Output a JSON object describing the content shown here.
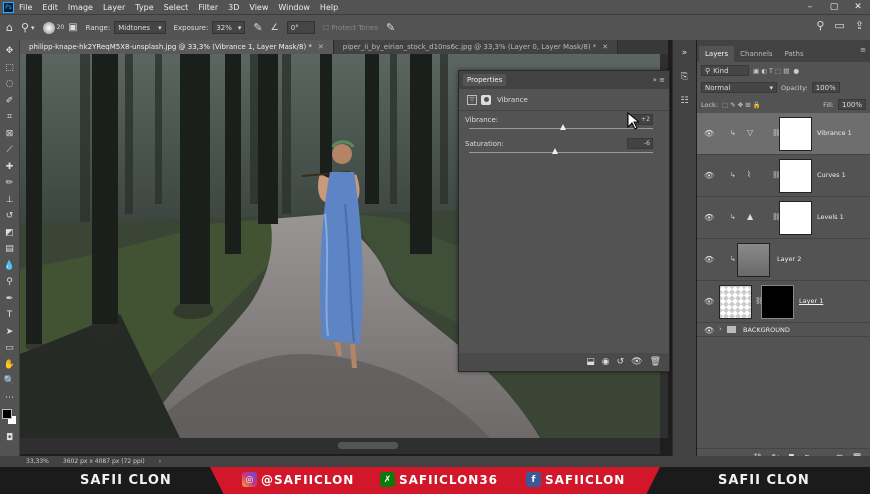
{
  "menu": {
    "logo": "Ps",
    "items": [
      "File",
      "Edit",
      "Image",
      "Layer",
      "Type",
      "Select",
      "Filter",
      "3D",
      "View",
      "Window",
      "Help"
    ]
  },
  "options": {
    "brush_size": "20",
    "range_label": "Range:",
    "range_value": "Midtones",
    "exposure_label": "Exposure:",
    "exposure_value": "32%",
    "angle_value": "0°",
    "protect_tones": "Protect Tones"
  },
  "tabs": [
    {
      "label": "philipp-knape-hk2YReqM5X8-unsplash.jpg @ 33,3% (Vibrance 1, Layer Mask/8) *",
      "active": true
    },
    {
      "label": "piper_ii_by_eirian_stock_d10ns6c.jpg @ 33,3% (Layer 0, Layer Mask/8) *",
      "active": false
    }
  ],
  "properties": {
    "title": "Properties",
    "adjustment_name": "Vibrance",
    "sliders": [
      {
        "label": "Vibrance:",
        "value": "+2",
        "pos": 0.51
      },
      {
        "label": "Saturation:",
        "value": "-6",
        "pos": 0.47
      }
    ]
  },
  "panel": {
    "tabs": [
      "Layers",
      "Channels",
      "Paths"
    ],
    "kind_filter": "Kind",
    "blend_mode": "Normal",
    "opacity_label": "Opacity:",
    "opacity_value": "100%",
    "lock_label": "Lock:",
    "fill_label": "Fill:",
    "fill_value": "100%"
  },
  "layers": [
    {
      "name": "Vibrance 1",
      "type": "vibrance",
      "selected": true
    },
    {
      "name": "Curves 1",
      "type": "curves",
      "selected": false
    },
    {
      "name": "Levels 1",
      "type": "levels",
      "selected": false
    },
    {
      "name": "Layer 2",
      "type": "pixel",
      "selected": false
    },
    {
      "name": "Layer 1",
      "type": "masked",
      "selected": false
    }
  ],
  "group": {
    "name": "BACKGROUND"
  },
  "status": {
    "zoom": "33,33%",
    "doc_size": "3602 px x 4087 px (72 ppi)"
  },
  "banner": {
    "name_left": "SAFII CLON",
    "instagram": "@SAFIICLON",
    "xbox": "SAFIICLON36",
    "facebook": "SAFIICLON",
    "name_right": "SAFII CLON",
    "colors": {
      "band": "#d2172a",
      "dark": "#1b1b1b"
    }
  }
}
